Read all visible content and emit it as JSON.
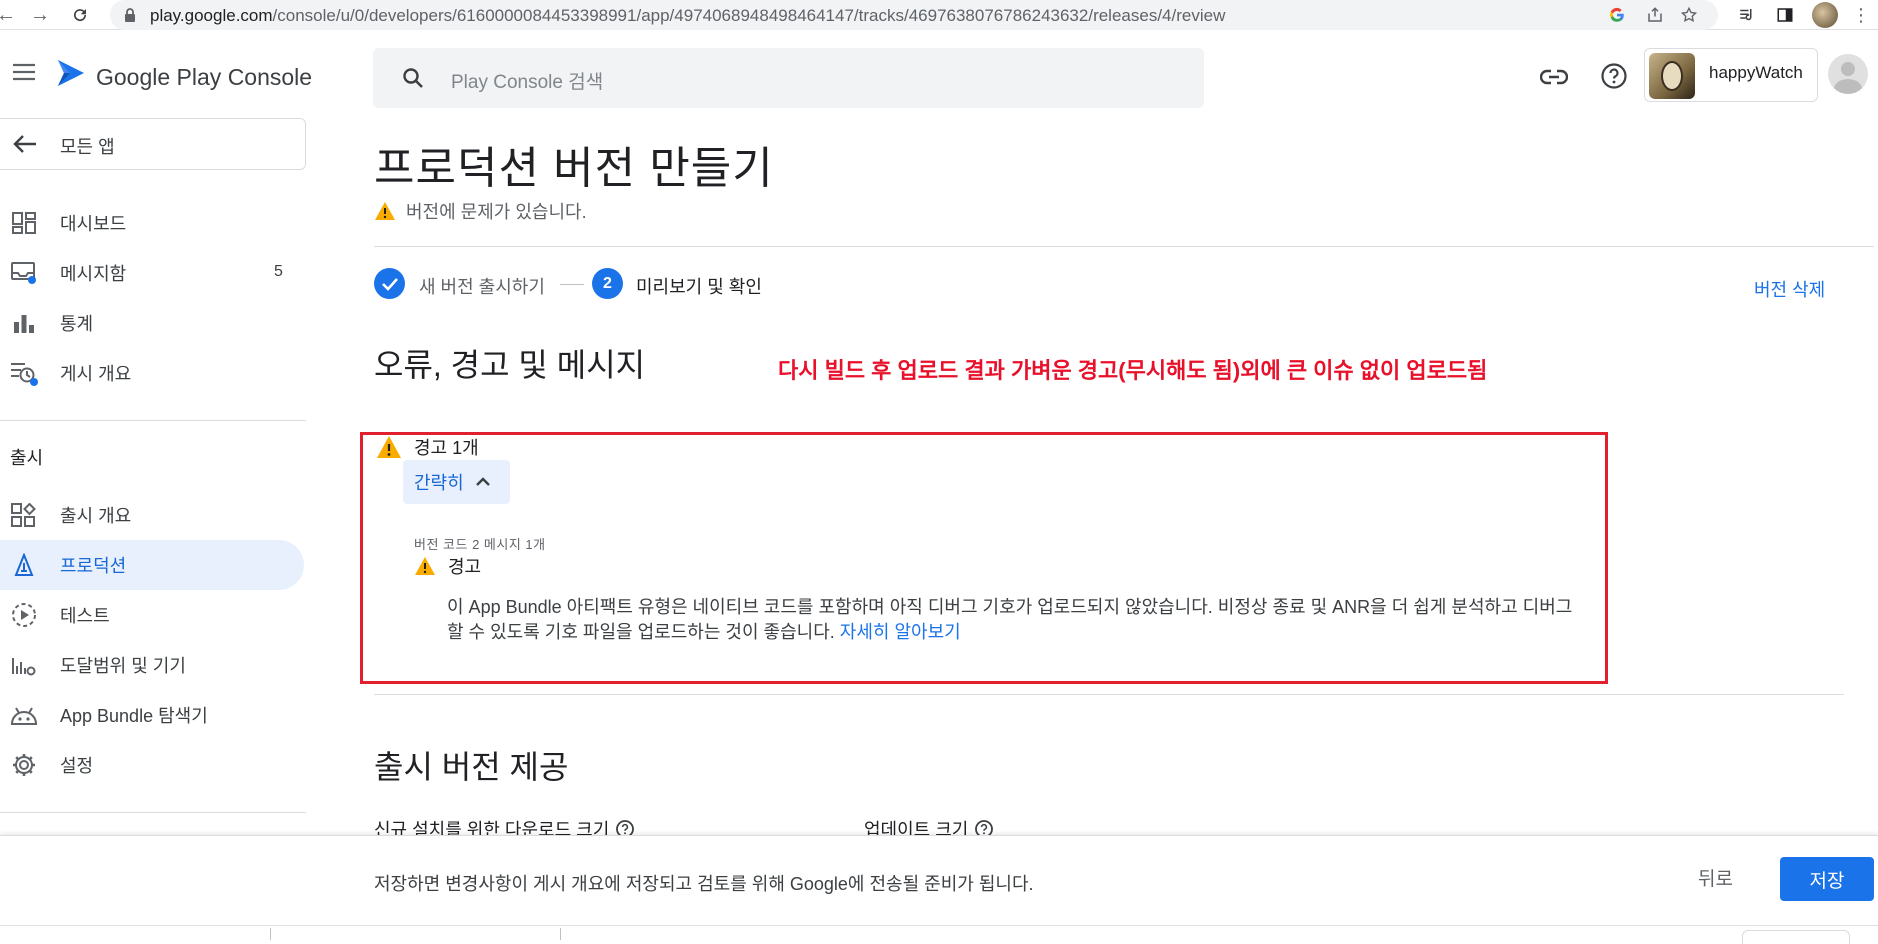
{
  "browser": {
    "url_domain": "play.google.com",
    "url_path": "/console/u/0/developers/6160000084453398991/app/4974068948498464147/tracks/4697638076786243632/releases/4/review"
  },
  "header": {
    "brand": "Google Play Console",
    "search_placeholder": "Play Console 검색",
    "account_name": "happyWatch"
  },
  "sidebar": {
    "back_label": "모든 앱",
    "items": [
      {
        "label": "대시보드",
        "icon": "dashboard-icon"
      },
      {
        "label": "메시지함",
        "icon": "inbox-icon",
        "badge": "5"
      },
      {
        "label": "통계",
        "icon": "bar-chart-icon"
      },
      {
        "label": "게시 개요",
        "icon": "publishing-overview-icon"
      }
    ],
    "section_label": "출시",
    "release_items": [
      {
        "label": "출시 개요",
        "icon": "release-overview-icon"
      },
      {
        "label": "프로덕션",
        "icon": "production-icon",
        "active": true
      },
      {
        "label": "테스트",
        "icon": "testing-icon"
      },
      {
        "label": "도달범위 및 기기",
        "icon": "reach-devices-icon"
      },
      {
        "label": "App Bundle 탐색기",
        "icon": "android-icon"
      },
      {
        "label": "설정",
        "icon": "gear-icon"
      }
    ]
  },
  "main": {
    "title": "프로덕션 버전 만들기",
    "problem_text": "버전에 문제가 있습니다.",
    "delete_label": "버전 삭제",
    "steps": [
      {
        "label": "새 버전 출시하기",
        "state": "done"
      },
      {
        "number": "2",
        "label": "미리보기 및 확인",
        "state": "current"
      }
    ],
    "section_title": "오류, 경고 및 메시지",
    "annotation": "다시 빌드 후 업로드 결과 가벼운 경고(무시해도 됨)외에 큰 이슈 없이 업로드됨",
    "warning_summary": "경고 1개",
    "collapse_label": "간략히",
    "message_meta": "버전 코드 2 메시지 1개",
    "message_kind": "경고",
    "message_body": "이 App Bundle 아티팩트 유형은 네이티브 코드를 포함하며 아직 디버그 기호가 업로드되지 않았습니다. 비정상 종료 및 ANR을 더 쉽게 분석하고 디버그할 수 있도록 기호 파일을 업로드하는 것이 좋습니다.",
    "learn_more": "자세히 알아보기",
    "section2_title": "출시 버전 제공",
    "download_size_label": "신규 설치를 위한 다운로드 크기",
    "update_size_label": "업데이트 크기"
  },
  "bottom_bar": {
    "text": "저장하면 변경사항이 게시 개요에 저장되고 검토를 위해 Google에 전송될 준비가 됩니다.",
    "back_label": "뒤로",
    "save_label": "저장"
  },
  "colors": {
    "accent": "#1a73e8",
    "warning": "#f9ab00",
    "annotation_red": "#e8102a"
  }
}
